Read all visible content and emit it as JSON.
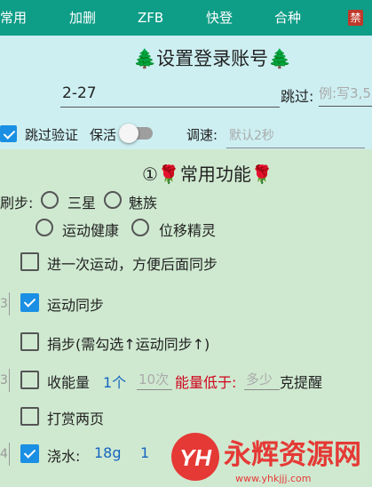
{
  "tabs": [
    {
      "label": "常用",
      "active": true
    },
    {
      "label": "加删",
      "active": false
    },
    {
      "label": "ZFB",
      "active": false
    },
    {
      "label": "快登",
      "active": false
    },
    {
      "label": "合种",
      "active": false
    }
  ],
  "close_tab_label": "禁",
  "account": {
    "title": "设置登录账号",
    "account_value": "2-27",
    "skip_label": "跳过:",
    "skip_placeholder": "例:写3,5",
    "skip_verify_label": "跳过验证",
    "skip_verify_checked": true,
    "keepalive_label": "保活",
    "keepalive_on": false,
    "speed_label": "调速:",
    "speed_placeholder": "默认2秒"
  },
  "functions": {
    "title": "①🌹常用功能🌹",
    "brush_label": "刷步:",
    "options": [
      "三星",
      "魅族",
      "运动健康",
      "位移精灵"
    ],
    "rows": [
      {
        "label": "进一次运动，方便后面同步",
        "checked": false
      },
      {
        "label": "运动同步",
        "checked": true
      },
      {
        "label": "捐步(需勾选↑运动同步↑)",
        "checked": false
      },
      {
        "label": "收能量",
        "checked": false
      },
      {
        "label": "打赏两页",
        "checked": false
      },
      {
        "label": "浇水:",
        "checked": true
      }
    ],
    "energy": {
      "count": "1个",
      "times_placeholder": "10次",
      "low_label": "能量低于:",
      "amount_placeholder": "多少",
      "remind_label": "克提醒"
    },
    "water": {
      "grams": "18g",
      "extra": "1"
    },
    "edge_values": [
      "3",
      "3",
      "4"
    ]
  },
  "watermark": {
    "logo_text": "YH",
    "brand": "永辉资源网",
    "url": "www.yhkjjj.com"
  },
  "colors": {
    "tab_bar": "#0e9d87",
    "account_bg": "#cdeff2",
    "functions_bg": "#cfe9d0",
    "checkbox_on": "#1a8fe3",
    "accent_red": "#d0021b",
    "accent_blue": "#1565c0"
  }
}
